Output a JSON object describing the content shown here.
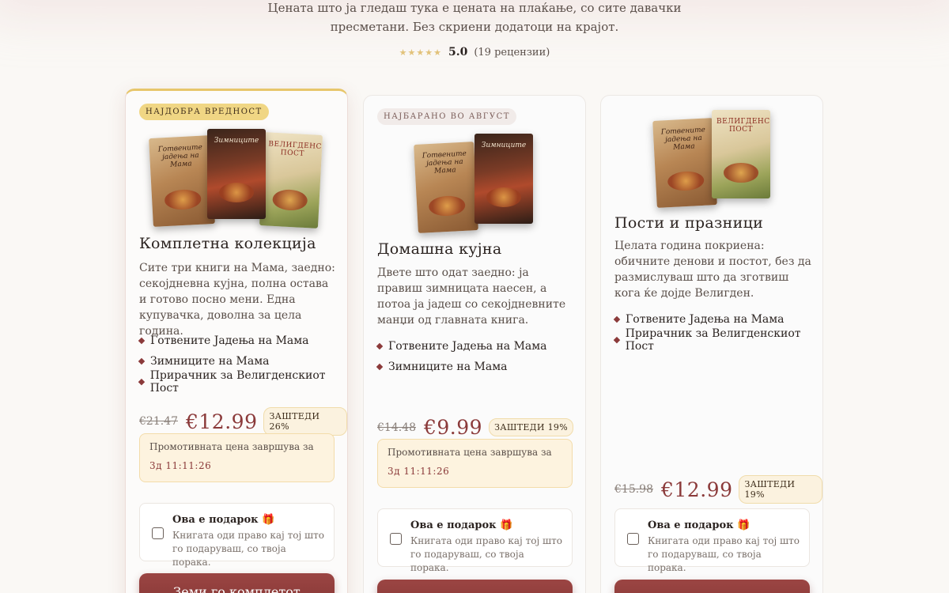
{
  "header": {
    "intro_line1": "Цената што ја гледаш тука е цената на плаќање, со сите давачки",
    "intro_line2": "пресметани. Без скриени додатоци на крајот.",
    "stars": "★★★★★",
    "score": "5.0",
    "reviews": "(19 рецензии)"
  },
  "plans": [
    {
      "badge": "НАЈДОБРА ВРЕДНОСТ",
      "title": "Комплетна колекција",
      "description": "Сите три книги на Мама, заедно: секојдневна кујна, полна остава и готово посно мени. Една купувачка, доволна за цела година.",
      "features": [
        "Готвените Јадења на Мама",
        "Зимниците на Мама",
        "Прирачник за Велигденскиот Пост"
      ],
      "old_price": "€21.47",
      "price": "€12.99",
      "save": "ЗАШТЕДИ 26%",
      "promo_label": "Промотивната цена завршува за",
      "promo_timer": "3д 11:11:26",
      "gift_title": "Ова е подарок",
      "gift_desc": "Книгата оди право кај тој што го подаруваш, со твоја порака.",
      "cta": "Земи го комплетот"
    },
    {
      "badge": "НАЈБАРАНО ВО АВГУСТ",
      "title": "Домашна кујна",
      "description": "Двете што одат заедно: ја правиш зимницата наесен, а потоа ја јадеш со секојдневните манџи од главната книга.",
      "features": [
        "Готвените Јадења на Мама",
        "Зимниците на Мама"
      ],
      "old_price": "€14.48",
      "price": "€9.99",
      "save": "ЗАШТЕДИ 19%",
      "promo_label": "Промотивната цена завршува за",
      "promo_timer": "3д 11:11:26",
      "gift_title": "Ова е подарок",
      "gift_desc": "Книгата оди право кај тој што го подаруваш, со твоја порака."
    },
    {
      "title": "Пости и празници",
      "description": "Целата година покриена: обичните денови и постот, без да размислуваш што да зготвиш кога ќе дојде Велигден.",
      "features": [
        "Готвените Јадења на Мама",
        "Прирачник за Велигденскиот Пост"
      ],
      "old_price": "€15.98",
      "price": "€12.99",
      "save": "ЗАШТЕДИ 19%",
      "gift_title": "Ова е подарок",
      "gift_desc": "Книгата оди право кај тој што го подаруваш, со твоја порака."
    }
  ],
  "covers": {
    "book1": "Готвените јадења на Мама",
    "book2": "Зимниците",
    "book3": "ВЕЛИГДЕНСКИ ПОСТ"
  },
  "icons": {
    "gift": "gift-icon",
    "star": "star-icon",
    "bullet": "diamond-bullet-icon"
  },
  "colors": {
    "accent": "#8b3a3a",
    "gold": "#e7c66b",
    "promo_bg": "#fdf3df"
  }
}
